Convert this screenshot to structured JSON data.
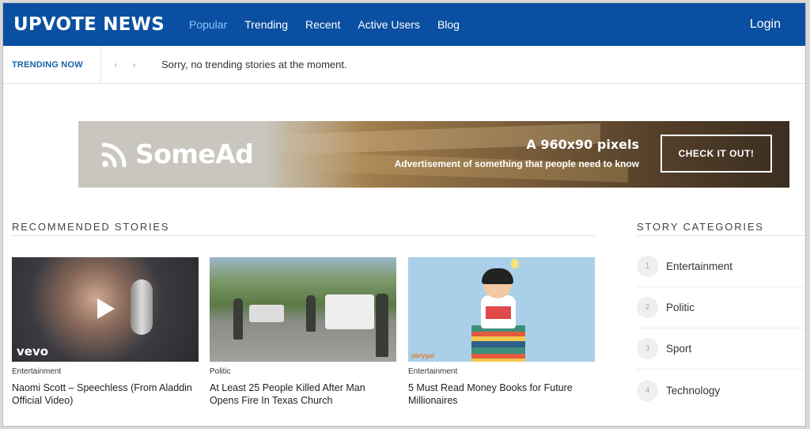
{
  "header": {
    "logo": "UPVOTE NEWS",
    "nav": [
      "Popular",
      "Trending",
      "Recent",
      "Active Users",
      "Blog"
    ],
    "login": "Login",
    "accent": "#0a4fa1"
  },
  "trending": {
    "label": "TRENDING NOW",
    "prev_icon": "‹",
    "next_icon": "›",
    "message": "Sorry, no trending stories at the moment."
  },
  "ad": {
    "brand": "SomeAd",
    "title": "A 960x90 pixels",
    "subtitle": "Advertisement of something that people need to know",
    "button": "CHECK IT OUT!"
  },
  "recommended": {
    "heading": "RECOMMENDED STORIES",
    "stories": [
      {
        "category": "Entertainment",
        "title": "Naomi Scott – Speechless (From Aladdin Official Video)",
        "badge": "vevo"
      },
      {
        "category": "Politic",
        "title": "At Least 25 People Killed After Man Opens Fire In Texas Church"
      },
      {
        "category": "Entertainment",
        "title": "5 Must Read Money Books for Future Millionaires",
        "badge": "pbrygal"
      }
    ]
  },
  "categories": {
    "heading": "STORY CATEGORIES",
    "items": [
      {
        "num": "1",
        "name": "Entertainment"
      },
      {
        "num": "2",
        "name": "Politic"
      },
      {
        "num": "3",
        "name": "Sport"
      },
      {
        "num": "4",
        "name": "Technology"
      }
    ]
  }
}
